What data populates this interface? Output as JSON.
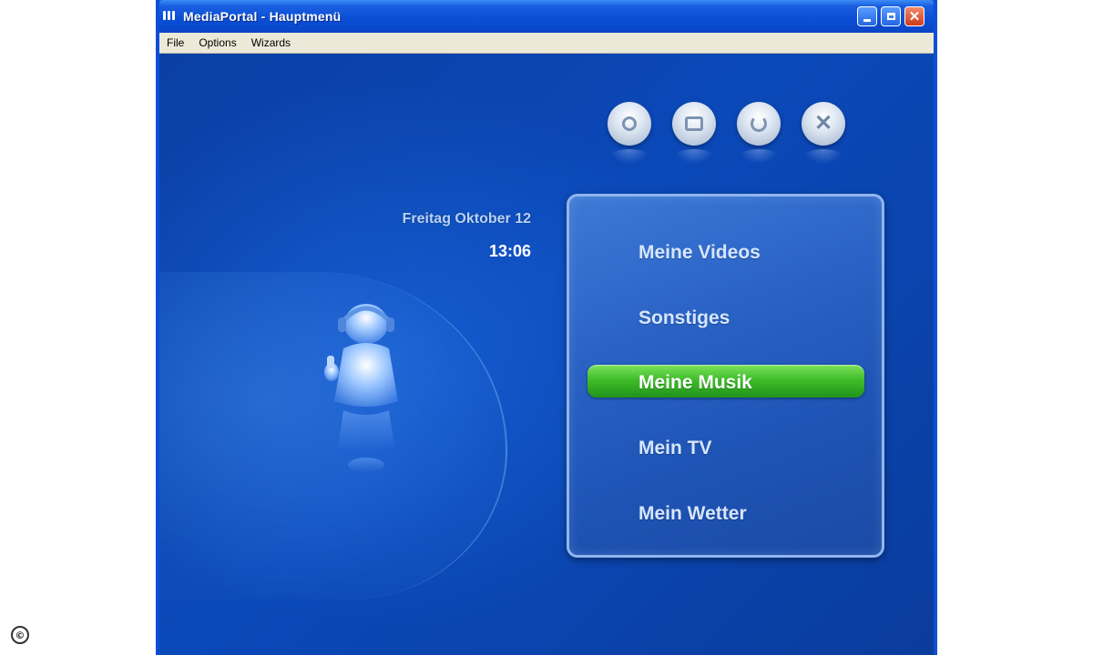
{
  "window": {
    "title": "MediaPortal - Hauptmenü",
    "menu": [
      "File",
      "Options",
      "Wizards"
    ]
  },
  "toolbar_buttons": [
    {
      "icon": "power-icon"
    },
    {
      "icon": "window-icon"
    },
    {
      "icon": "restart-icon"
    },
    {
      "icon": "close-x-icon"
    }
  ],
  "clock": {
    "date": "Freitag Oktober 12",
    "time": "13:06"
  },
  "main_menu": {
    "items": [
      "Meine Videos",
      "Sonstiges",
      "Meine Musik",
      "Mein TV",
      "Mein Wetter"
    ],
    "selected": "Meine Musik"
  },
  "colors": {
    "background": "#0a44ae",
    "highlight": "#3fbd2a",
    "panel": "#2a63c5"
  },
  "watermark": "©"
}
